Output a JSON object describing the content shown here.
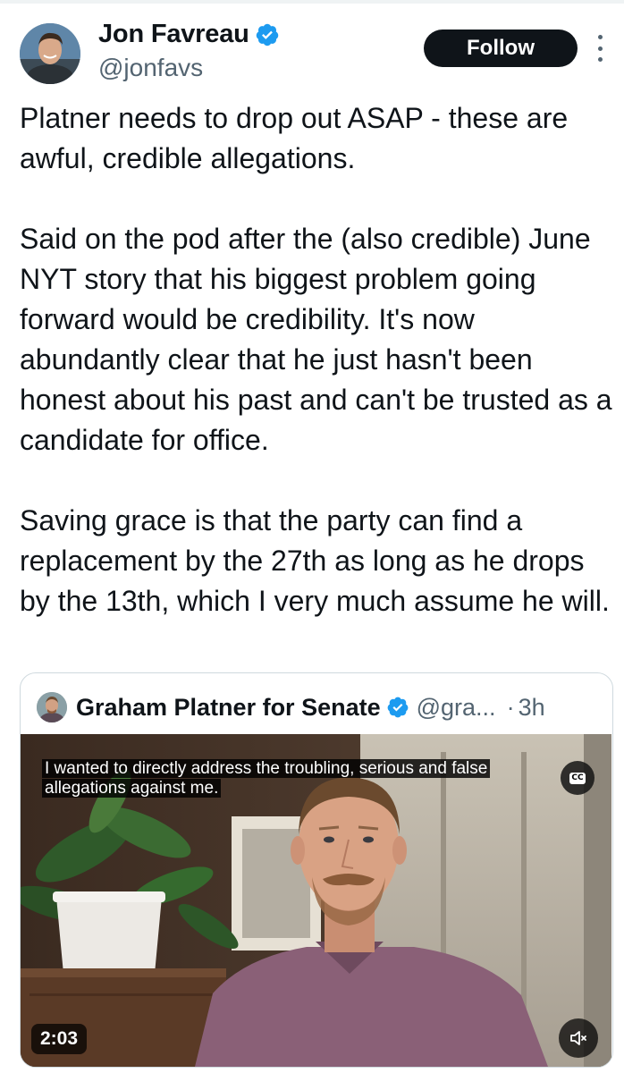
{
  "author": {
    "display_name": "Jon Favreau",
    "handle": "@jonfavs",
    "avatar_icon": "profile-photo",
    "verified_icon": "verified-badge-icon",
    "verified_color": "#1d9bf0"
  },
  "follow_label": "Follow",
  "more_icon": "more-options-icon",
  "tweet": {
    "paragraphs": [
      "Platner needs to drop out ASAP - these are awful, credible allegations.",
      "Said on the pod after the (also credible) June NYT story that his biggest problem going forward would be credibility. It's now abundantly clear that he just hasn't been honest about his past and can't be trusted as a candidate for office.",
      "Saving grace is that the party can find a replacement by the 27th as long as he drops by the 13th, which I very much assume he will."
    ]
  },
  "quote": {
    "display_name": "Graham Platner for Senate",
    "handle": "@gra...",
    "separator": "·",
    "time": "3h",
    "video": {
      "caption": "I wanted to directly address the troubling, serious and false allegations against me.",
      "cc_label": "CC",
      "duration": "2:03",
      "mute_icon": "muted-speaker-icon"
    }
  },
  "colors": {
    "text": "#0f1419",
    "secondary": "#536471",
    "border": "#cfd9de",
    "follow_bg": "#0f1419"
  }
}
